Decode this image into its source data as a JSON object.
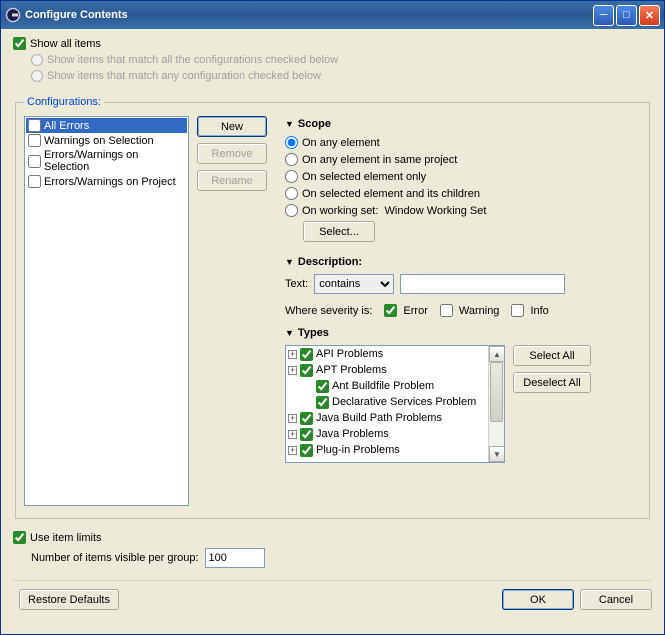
{
  "window": {
    "title": "Configure Contents"
  },
  "top": {
    "showAll": "Show all items",
    "matchAll": "Show items that match all the configurations checked below",
    "matchAny": "Show items that match any configuration checked below"
  },
  "configurations": {
    "legend": "Configurations:",
    "items": [
      "All Errors",
      "Warnings on Selection",
      "Errors/Warnings on Selection",
      "Errors/Warnings on Project"
    ],
    "newBtn": "New",
    "removeBtn": "Remove",
    "renameBtn": "Rename"
  },
  "scope": {
    "header": "Scope",
    "opt1": "On any element",
    "opt2": "On any element in same project",
    "opt3": "On selected element only",
    "opt4": "On selected element and its children",
    "opt5": "On working set:",
    "wsName": "Window Working Set",
    "selectBtn": "Select..."
  },
  "description": {
    "header": "Description:",
    "textLabel": "Text:",
    "containsOpt": "contains",
    "severityLabel": "Where severity is:",
    "error": "Error",
    "warning": "Warning",
    "info": "Info"
  },
  "types": {
    "header": "Types",
    "items": [
      "API Problems",
      "APT Problems",
      "Ant Buildfile Problem",
      "Declarative Services Problem",
      "Java Build Path Problems",
      "Java Problems",
      "Plug-in Problems"
    ],
    "selectAll": "Select All",
    "deselectAll": "Deselect All"
  },
  "limits": {
    "use": "Use item limits",
    "label": "Number of items visible per group:",
    "value": "100"
  },
  "buttons": {
    "restore": "Restore Defaults",
    "ok": "OK",
    "cancel": "Cancel"
  }
}
